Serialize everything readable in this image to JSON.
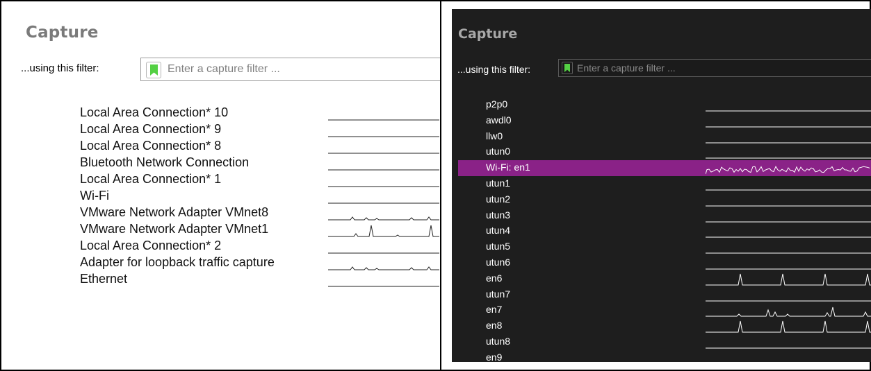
{
  "windows_panel": {
    "title": "Capture",
    "filter_label": "...using this filter:",
    "filter_placeholder": "Enter a capture filter ...",
    "interfaces": [
      {
        "name": "Local Area Connection* 10",
        "activity": "flat"
      },
      {
        "name": "Local Area Connection* 9",
        "activity": "flat"
      },
      {
        "name": "Local Area Connection* 8",
        "activity": "flat"
      },
      {
        "name": "Bluetooth Network Connection",
        "activity": "flat"
      },
      {
        "name": "Local Area Connection* 1",
        "activity": "flat"
      },
      {
        "name": "Wi-Fi",
        "activity": "flat"
      },
      {
        "name": "VMware Network Adapter VMnet8",
        "activity": "small-bumps"
      },
      {
        "name": "VMware Network Adapter VMnet1",
        "activity": "spikes"
      },
      {
        "name": "Local Area Connection* 2",
        "activity": "flat"
      },
      {
        "name": "Adapter for loopback traffic capture",
        "activity": "small-bumps"
      },
      {
        "name": "Ethernet",
        "activity": "flat"
      }
    ]
  },
  "macos_panel": {
    "title": "Capture",
    "filter_label": "...using this filter:",
    "filter_placeholder": "Enter a capture filter ...",
    "selected_color": "#8a2287",
    "interfaces": [
      {
        "name": "p2p0",
        "activity": "flat",
        "selected": false
      },
      {
        "name": "awdl0",
        "activity": "flat",
        "selected": false
      },
      {
        "name": "llw0",
        "activity": "flat",
        "selected": false
      },
      {
        "name": "utun0",
        "activity": "flat",
        "selected": false
      },
      {
        "name": "Wi-Fi: en1",
        "activity": "busy",
        "selected": true
      },
      {
        "name": "utun1",
        "activity": "flat",
        "selected": false
      },
      {
        "name": "utun2",
        "activity": "flat",
        "selected": false
      },
      {
        "name": "utun3",
        "activity": "flat",
        "selected": false
      },
      {
        "name": "utun4",
        "activity": "flat",
        "selected": false
      },
      {
        "name": "utun5",
        "activity": "flat",
        "selected": false
      },
      {
        "name": "utun6",
        "activity": "flat",
        "selected": false
      },
      {
        "name": "en6",
        "activity": "periodic-spikes",
        "selected": false
      },
      {
        "name": "utun7",
        "activity": "flat",
        "selected": false
      },
      {
        "name": "en7",
        "activity": "mixed-spikes",
        "selected": false
      },
      {
        "name": "en8",
        "activity": "periodic-spikes",
        "selected": false
      },
      {
        "name": "utun8",
        "activity": "flat",
        "selected": false
      },
      {
        "name": "en9",
        "activity": "flat",
        "selected": false
      }
    ]
  }
}
